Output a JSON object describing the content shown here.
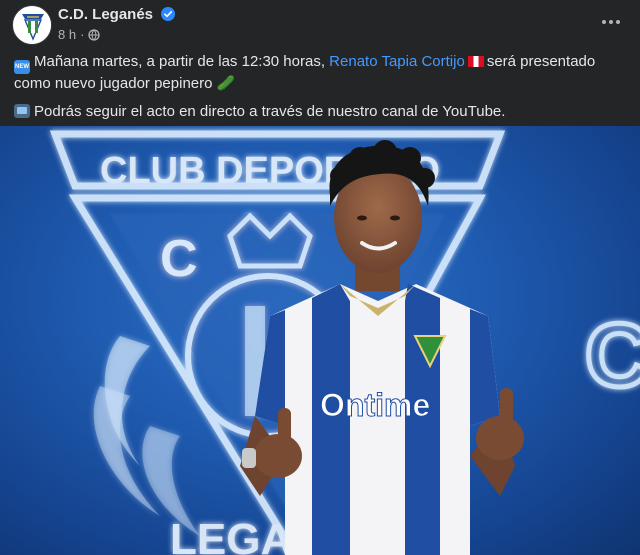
{
  "post": {
    "page_name": "C.D. Leganés",
    "time": "8 h",
    "verified": true,
    "line1_before": "Mañana martes, a partir de las 12:30 horas,",
    "mention": "Renato Tapia Cortijo",
    "line1_after": "será presentado como nuevo jugador pepinero",
    "line2": "Podrás seguir el acto en directo a través de nuestro canal de YouTube.",
    "new_badge": "NEW",
    "trailing_emoji": "🥒"
  },
  "photo": {
    "sign_top_text": "CLUB DEPORTIVO",
    "sign_mid_text": "C",
    "sign_bottom_text": "LEGA",
    "shirt_sponsor": "Ontime",
    "right_letter": "C"
  },
  "colors": {
    "background": "#242526",
    "text": "#e4e6eb",
    "secondary": "#b0b3b8",
    "link": "#4599ff",
    "verified": "#2d88ff",
    "photo_blue": "#1f5bb0",
    "shirt_blue": "#1f4ea3"
  },
  "icons": [
    "club-crest-icon",
    "verified-badge-icon",
    "globe-icon",
    "more-options-icon",
    "new-emoji-icon",
    "peru-flag-icon",
    "tv-emoji-icon"
  ]
}
